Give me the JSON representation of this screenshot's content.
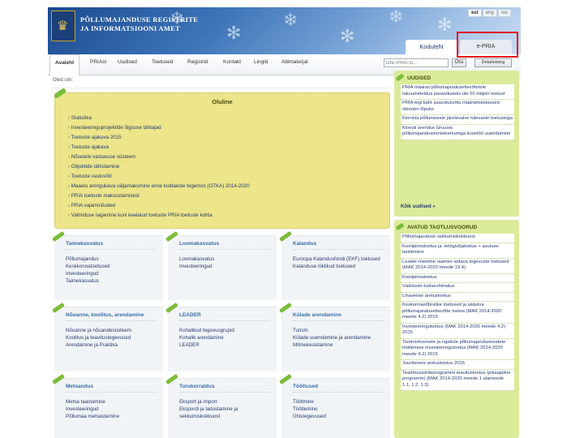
{
  "header": {
    "org_line1": "PÕLLUMAJANDUSE REGISTRITE",
    "org_line2": "JA INFORMATSIOONI AMET",
    "languages": [
      "est",
      "eng",
      "rus"
    ],
    "home_tab": "Koduleht",
    "pria_tab": "e-PRIA"
  },
  "nav": {
    "items": [
      "Avaleht",
      "PRIAst",
      "Uudised",
      "Toetused",
      "Registrid",
      "Kontakt",
      "Lingid",
      "Abimaterjal"
    ],
    "search_placeholder": "Otsi PRIA-st...",
    "search_button": "Otsi",
    "advanced_search": "Detailotsing"
  },
  "breadcrumb": "Oled siin: ",
  "important": {
    "title": "Oluline",
    "items": [
      "Statistika",
      "Investeeringuprojektide õigsuse tähtajad",
      "Toetuste ajakava 2015",
      "Toetuste ajakava",
      "Nõuetele vastavuse süsteem",
      "Objektide tähistamine",
      "Toetuste vastuvõtt",
      "Maaelu arengukava väljamaksmine enne kuldaeste tegemist (OTKA) 2014-2020",
      "PRIA toetuste maksustamisest",
      "PRIA vajaminõuded",
      "Valmiduse tagamine kuni keelatud toetuste PRIA toetuste kohta"
    ]
  },
  "categories": [
    {
      "title": "Taimekasvatus",
      "links": [
        "Põllumajandus",
        "Keskkonnatoetused",
        "Investeeringud",
        "Taimekasvatus"
      ]
    },
    {
      "title": "Loomakasvatus",
      "links": [
        "Loomakasvatus",
        "Investeeringud"
      ]
    },
    {
      "title": "Kalandus",
      "links": [
        "Euroopa Kalandusfondi (EKF) toetused",
        "Kalanduse riiklikud toetused"
      ]
    },
    {
      "title": "Nõuanne, koolitus, arendamine",
      "links": [
        "Nõuanne ja nõuandesüsteem",
        "Koolitus ja teavitustegevused",
        "Arendamine ja Praktika"
      ]
    },
    {
      "title": "LEADER",
      "links": [
        "Kohalikud tegevusgrupid",
        "Kohalik arendamine",
        "LEADER"
      ]
    },
    {
      "title": "Külade arendamine",
      "links": [
        "Turism",
        "Külade uuendamine ja arendamine",
        "Mitmekesistamine"
      ]
    },
    {
      "title": "Metsandus",
      "links": [
        "Metsa taastamine",
        "Investeeringud",
        "Põllumaa metsastamine"
      ]
    },
    {
      "title": "Turukorraldus",
      "links": [
        "Eksport ja import",
        "Ekspordi ja ladustamine ja sekkumiskokkuost"
      ]
    },
    {
      "title": "Töötlused",
      "links": [
        "Töötmine",
        "Töötlemine",
        "Ühistegevused"
      ]
    }
  ],
  "news": {
    "title": "UUDISED",
    "items": [
      "PRIA määras põllumajandusettevõtetele taluvaheteldus paranduseks üle 50 miljoni toetust",
      "PRIA tegi kaht saavutusvõtu määramisetsused oktoobri lõpuks",
      "Kinnisla põllumeeste järelevalve tulevaste toetustega",
      "Kiiresti arendus Gruusia põllumajandusministeeriumiga koostöö uuendamine"
    ],
    "more": "Kõik uudised »"
  },
  "rounds": {
    "title": "AVATUD TAOTLUSVOORUD",
    "items": [
      "Põllumajanduse sekkumiskokkuost",
      "Koolipiimatoetus ja -köögiviljatoetus + asutuse taotlemine",
      "Leader-meetme raames antava tegevuste toetused (MAK 2014-2020 meede 19.4)",
      "Koolipiimatoetus",
      "Väärtuste kaitsevõimalus",
      "Lihaveiste aretustoetus",
      "Keskonnasõbralike toetused ja säästva põllumajandusettevõtte toetus (MAK 2014-2020 meede 4.2) 2015",
      "Investeeringutoetus (MAK 2014-2020 meede 4.2) 2015",
      "Tootmishoonete ja rajatiste põllumajandustoodete töötlemise investeeringutoetus (MAK 2014-2020 meede 4.2) 2015",
      "Juurdevere aretustoetus 2015",
      "Teadmussiirdeprogrammi teavitustoetus (pikaajaline programm) (MAK 2014-2020 meede 1 alameede 1.1, 1.2, 1.3)"
    ]
  }
}
